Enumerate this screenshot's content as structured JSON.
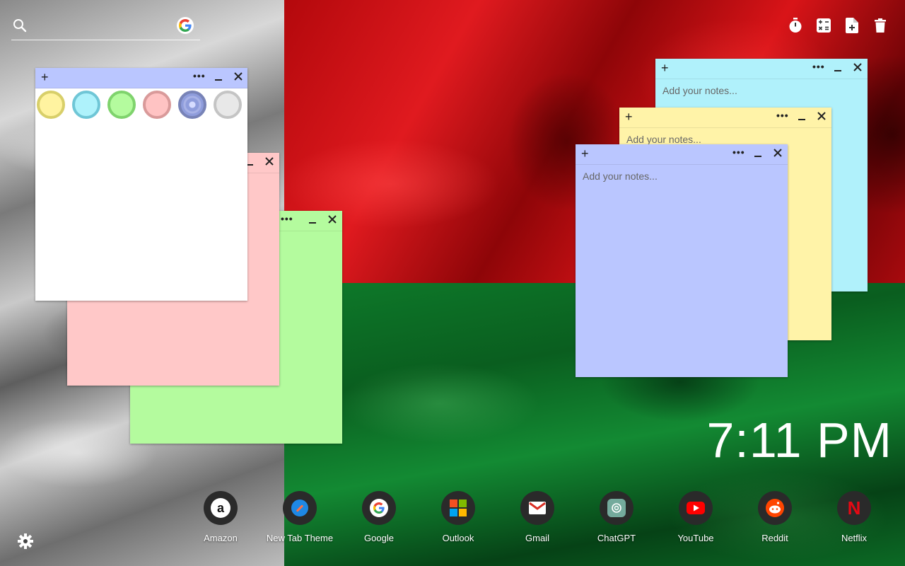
{
  "search": {
    "placeholder": "",
    "value": ""
  },
  "toolbar": {
    "tools": [
      {
        "icon": "timer-icon"
      },
      {
        "icon": "calculator-icon"
      },
      {
        "icon": "add-note-icon"
      },
      {
        "icon": "trash-icon"
      }
    ]
  },
  "notes": {
    "placeholder": "Add your notes...",
    "add_label": "+",
    "more_label": "•••",
    "colors": {
      "white": "#ffffff",
      "pink": "#ffc8c8",
      "green": "#b4fb9e",
      "yellow": "#fff3a8",
      "cyan": "#b0f1fb",
      "blue": "#bac6ff"
    },
    "palette": [
      {
        "name": "yellow",
        "fill": "#fff3a0",
        "ring": "#d8cf6a"
      },
      {
        "name": "cyan",
        "fill": "#aef2fb",
        "ring": "#6fc6d6"
      },
      {
        "name": "green",
        "fill": "#b4fb9e",
        "ring": "#7fd36d"
      },
      {
        "name": "pink",
        "fill": "#ffc3c3",
        "ring": "#d99a9a"
      },
      {
        "name": "blue",
        "fill": "#8f9ddc",
        "ring": "#7883b7",
        "selected": true
      },
      {
        "name": "gray",
        "fill": "#e8e8e8",
        "ring": "#c4c4c4"
      }
    ]
  },
  "clock": {
    "time": "7:11 PM"
  },
  "dock": [
    {
      "label": "Amazon",
      "icon": "amazon-icon"
    },
    {
      "label": "New Tab Theme",
      "icon": "new-tab-theme-icon"
    },
    {
      "label": "Google",
      "icon": "google-icon"
    },
    {
      "label": "Outlook",
      "icon": "outlook-icon"
    },
    {
      "label": "Gmail",
      "icon": "gmail-icon"
    },
    {
      "label": "ChatGPT",
      "icon": "chatgpt-icon"
    },
    {
      "label": "YouTube",
      "icon": "youtube-icon"
    },
    {
      "label": "Reddit",
      "icon": "reddit-icon"
    },
    {
      "label": "Netflix",
      "icon": "netflix-icon"
    }
  ],
  "settings": {
    "icon": "gear-icon"
  }
}
